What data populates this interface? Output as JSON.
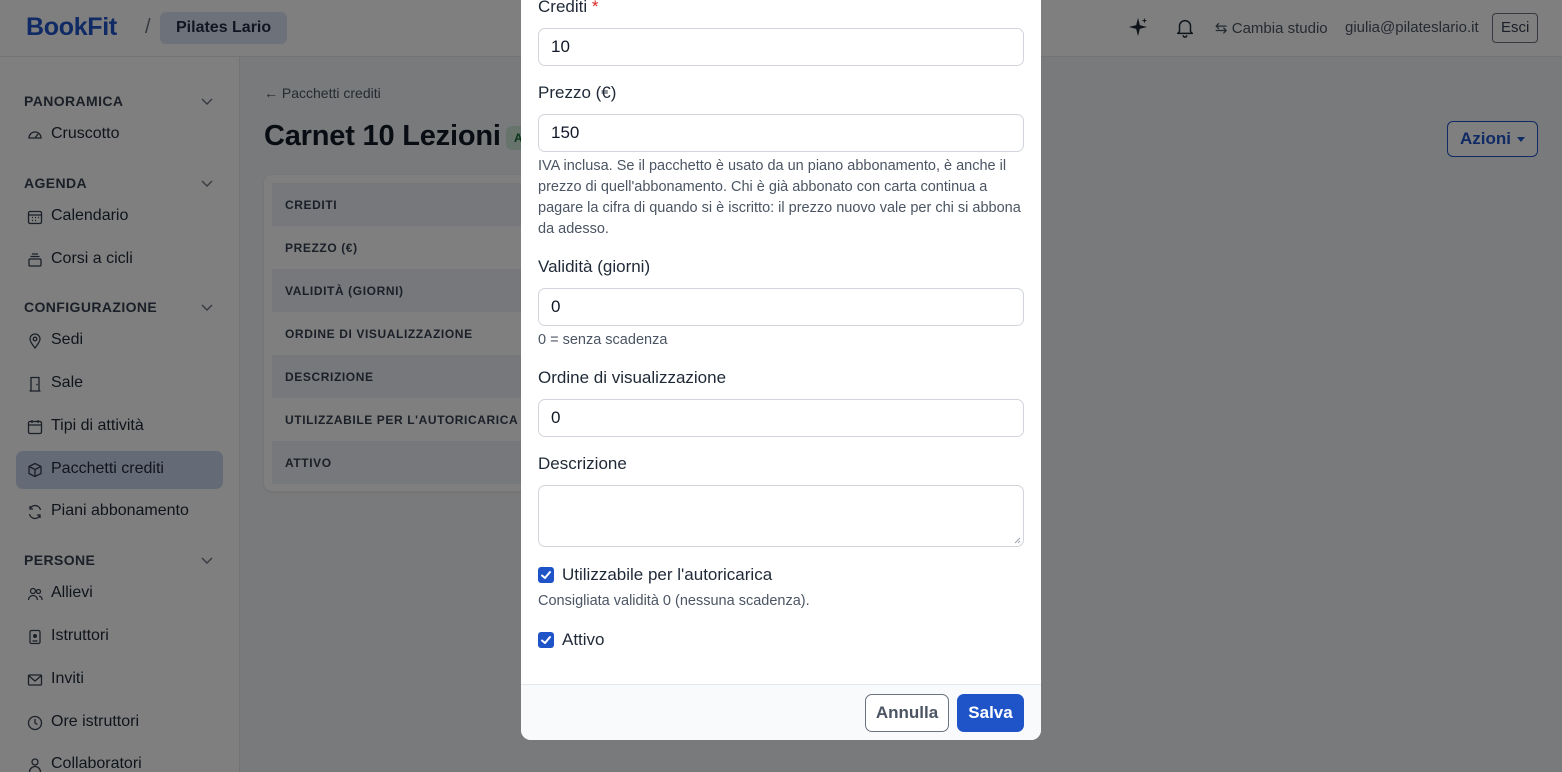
{
  "topbar": {
    "brand": "BookFit",
    "separator": "/",
    "studio": "Pilates Lario",
    "switch_studio": "⇆ Cambia studio",
    "email": "giulia@pilateslario.it",
    "logout": "Esci",
    "icons": [
      "sparkle-icon",
      "bell-icon",
      "swap-icon"
    ]
  },
  "sidebar": {
    "sections": [
      {
        "title": "PANORAMICA",
        "items": [
          {
            "label": "Cruscotto",
            "icon": "dashboard-icon"
          }
        ]
      },
      {
        "title": "AGENDA",
        "items": [
          {
            "label": "Calendario",
            "icon": "calendar-grid-icon"
          },
          {
            "label": "Corsi a cicli",
            "icon": "stack-icon"
          }
        ]
      },
      {
        "title": "CONFIGURAZIONE",
        "items": [
          {
            "label": "Sedi",
            "icon": "map-pin-icon"
          },
          {
            "label": "Sale",
            "icon": "door-icon"
          },
          {
            "label": "Tipi di attività",
            "icon": "calendar-icon"
          },
          {
            "label": "Pacchetti crediti",
            "icon": "box-icon",
            "active": true
          },
          {
            "label": "Piani abbonamento",
            "icon": "refresh-icon"
          }
        ]
      },
      {
        "title": "PERSONE",
        "items": [
          {
            "label": "Allievi",
            "icon": "users-icon"
          },
          {
            "label": "Istruttori",
            "icon": "badge-icon"
          },
          {
            "label": "Inviti",
            "icon": "mail-icon"
          },
          {
            "label": "Ore istruttori",
            "icon": "clock-icon"
          },
          {
            "label": "Collaboratori",
            "icon": "user-icon"
          }
        ]
      }
    ]
  },
  "main": {
    "breadcrumb": "← Pacchetti crediti",
    "title": "Carnet 10 Lezioni",
    "status_tag": "A",
    "actions_button": "Azioni",
    "detail_rows": [
      "CREDITI",
      "PREZZO (€)",
      "VALIDITÀ (GIORNI)",
      "ORDINE DI VISUALIZZAZIONE",
      "DESCRIZIONE",
      "UTILIZZABILE PER L'AUTORICARICA",
      "ATTIVO"
    ]
  },
  "modal": {
    "credits": {
      "label": "Crediti",
      "required_mark": "*",
      "value": "10"
    },
    "price": {
      "label": "Prezzo (€)",
      "value": "150",
      "help": "IVA inclusa. Se il pacchetto è usato da un piano abbonamento, è anche il prezzo di quell'abbonamento. Chi è già abbonato con carta continua a pagare la cifra di quando si è iscritto: il prezzo nuovo vale per chi si abbona da adesso."
    },
    "validity": {
      "label": "Validità (giorni)",
      "value": "0",
      "help": "0 = senza scadenza"
    },
    "order": {
      "label": "Ordine di visualizzazione",
      "value": "0"
    },
    "description": {
      "label": "Descrizione",
      "value": ""
    },
    "autorecharge": {
      "label": "Utilizzabile per l'autoricarica",
      "checked": true,
      "help": "Consigliata validità 0 (nessuna scadenza)."
    },
    "active": {
      "label": "Attivo",
      "checked": true
    },
    "cancel_button": "Annulla",
    "save_button": "Salva"
  },
  "colors": {
    "accent": "#1f54c9",
    "active_nav": "#c9d7ee",
    "required": "#dc2626"
  }
}
